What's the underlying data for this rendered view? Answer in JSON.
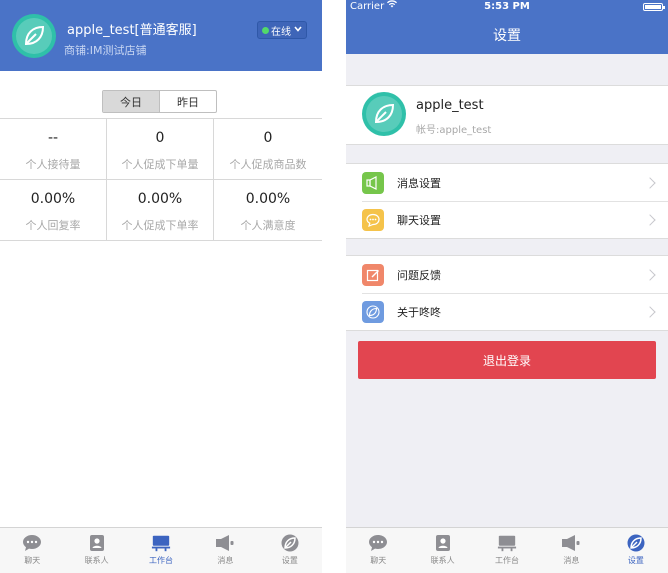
{
  "status_bar": {
    "carrier": "Carrier",
    "time": "5:53 PM"
  },
  "workbench": {
    "user_name": "apple_test[普通客服]",
    "shop_name": "商铺:IM测试店铺",
    "online_status": "在线",
    "day_toggle": {
      "today": "今日",
      "yesterday": "昨日",
      "selected": "今日"
    },
    "stats": [
      {
        "value": "--",
        "label": "个人接待量"
      },
      {
        "value": "0",
        "label": "个人促成下单量"
      },
      {
        "value": "0",
        "label": "个人促成商品数"
      },
      {
        "value": "0.00%",
        "label": "个人回复率"
      },
      {
        "value": "0.00%",
        "label": "个人促成下单率"
      },
      {
        "value": "0.00%",
        "label": "个人满意度"
      }
    ]
  },
  "settings": {
    "title": "设置",
    "profile": {
      "name": "apple_test",
      "account": "帐号:apple_test"
    },
    "menu_groups": [
      [
        {
          "label": "消息设置",
          "icon": "speaker-icon",
          "color": "#76c64b"
        },
        {
          "label": "聊天设置",
          "icon": "chat-icon",
          "color": "#f5c34a"
        }
      ],
      [
        {
          "label": "问题反馈",
          "icon": "edit-icon",
          "color": "#f0876a"
        },
        {
          "label": "关于咚咚",
          "icon": "leaf-icon",
          "color": "#6f9be0"
        }
      ]
    ],
    "logout_label": "退出登录"
  },
  "tabs": [
    {
      "label": "聊天",
      "icon": "chat-bubble-icon"
    },
    {
      "label": "联系人",
      "icon": "contacts-icon"
    },
    {
      "label": "工作台",
      "icon": "workbench-icon"
    },
    {
      "label": "消息",
      "icon": "megaphone-icon"
    },
    {
      "label": "设置",
      "icon": "settings-leaf-icon"
    }
  ],
  "left_active_tab": 2,
  "right_active_tab": 4,
  "colors": {
    "header": "#4a73c7",
    "accent": "#3c64c0",
    "logout": "#e24550",
    "avatar": "#2fc0a9",
    "online": "#52d96a"
  }
}
